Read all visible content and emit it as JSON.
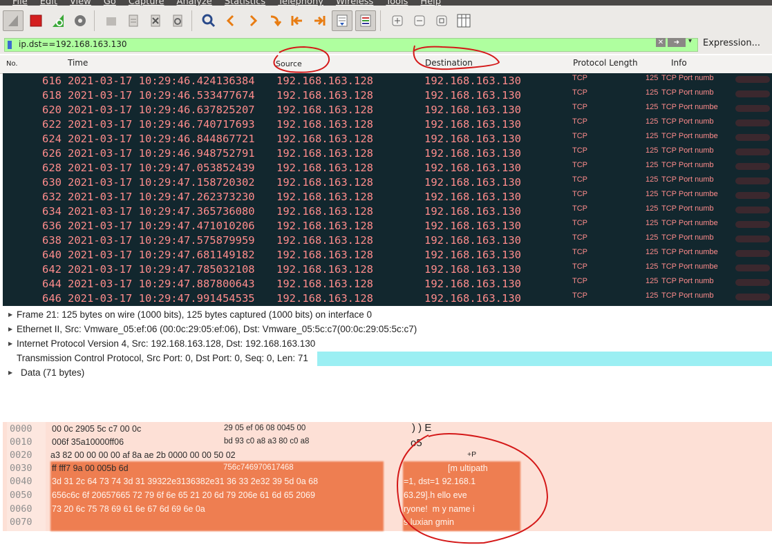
{
  "menubar": {
    "items": [
      "File",
      "Edit",
      "View",
      "Go",
      "Capture",
      "Analyze",
      "Statistics",
      "Telephony",
      "Wireless",
      "Tools",
      "Help"
    ]
  },
  "toolbar": {
    "icons": [
      "shark-fin-icon",
      "stop-capture-icon",
      "restart-capture-icon",
      "capture-options-icon",
      "open-file-icon",
      "save-file-icon",
      "close-file-icon",
      "reload-icon",
      "find-packet-icon",
      "go-back-icon",
      "go-forward-icon",
      "go-to-packet-icon",
      "first-packet-icon",
      "last-packet-icon",
      "autoscroll-icon",
      "colorize-icon",
      "zoom-in-icon",
      "zoom-out-icon",
      "normal-size-icon",
      "resize-columns-icon"
    ]
  },
  "filter": {
    "value": "ip.dst==192.168.163.130",
    "expression_label": "Expression..."
  },
  "columns": {
    "no": "No.",
    "time": "Time",
    "source": "Source",
    "destination": "Destination",
    "protocol": "Protocol",
    "length": "Length",
    "info": "Info"
  },
  "packets": [
    {
      "no": "616",
      "time": "2021-03-17 10:29:46.424136384",
      "src": "192.168.163.128",
      "dst": "192.168.163.130",
      "proto": "TCP",
      "len": "125",
      "info": "TCP Port numb"
    },
    {
      "no": "618",
      "time": "2021-03-17 10:29:46.533477674",
      "src": "192.168.163.128",
      "dst": "192.168.163.130",
      "proto": "TCP",
      "len": "125",
      "info": "TCP Port numb"
    },
    {
      "no": "620",
      "time": "2021-03-17 10:29:46.637825207",
      "src": "192.168.163.128",
      "dst": "192.168.163.130",
      "proto": "TCP",
      "len": "125",
      "info": "TCP Port numbe"
    },
    {
      "no": "622",
      "time": "2021-03-17 10:29:46.740717693",
      "src": "192.168.163.128",
      "dst": "192.168.163.130",
      "proto": "TCP",
      "len": "125",
      "info": "TCP Port numb"
    },
    {
      "no": "624",
      "time": "2021-03-17 10:29:46.844867721",
      "src": "192.168.163.128",
      "dst": "192.168.163.130",
      "proto": "TCP",
      "len": "125",
      "info": "TCP Port numbe"
    },
    {
      "no": "626",
      "time": "2021-03-17 10:29:46.948752791",
      "src": "192.168.163.128",
      "dst": "192.168.163.130",
      "proto": "TCP",
      "len": "125",
      "info": "TCP Port numb"
    },
    {
      "no": "628",
      "time": "2021-03-17 10:29:47.053852439",
      "src": "192.168.163.128",
      "dst": "192.168.163.130",
      "proto": "TCP",
      "len": "125",
      "info": "TCP Port numb"
    },
    {
      "no": "630",
      "time": "2021-03-17 10:29:47.158720302",
      "src": "192.168.163.128",
      "dst": "192.168.163.130",
      "proto": "TCP",
      "len": "125",
      "info": "TCP Port numb"
    },
    {
      "no": "632",
      "time": "2021-03-17 10:29:47.262373230",
      "src": "192.168.163.128",
      "dst": "192.168.163.130",
      "proto": "TCP",
      "len": "125",
      "info": "TCP Port numbe"
    },
    {
      "no": "634",
      "time": "2021-03-17 10:29:47.365736080",
      "src": "192.168.163.128",
      "dst": "192.168.163.130",
      "proto": "TCP",
      "len": "125",
      "info": "TCP Port numb"
    },
    {
      "no": "636",
      "time": "2021-03-17 10:29:47.471010206",
      "src": "192.168.163.128",
      "dst": "192.168.163.130",
      "proto": "TCP",
      "len": "125",
      "info": "TCP Port numbe"
    },
    {
      "no": "638",
      "time": "2021-03-17 10:29:47.575879959",
      "src": "192.168.163.128",
      "dst": "192.168.163.130",
      "proto": "TCP",
      "len": "125",
      "info": "TCP Port numb"
    },
    {
      "no": "640",
      "time": "2021-03-17 10:29:47.681149182",
      "src": "192.168.163.128",
      "dst": "192.168.163.130",
      "proto": "TCP",
      "len": "125",
      "info": "TCP Port numbe"
    },
    {
      "no": "642",
      "time": "2021-03-17 10:29:47.785032108",
      "src": "192.168.163.128",
      "dst": "192.168.163.130",
      "proto": "TCP",
      "len": "125",
      "info": "TCP Port numbe"
    },
    {
      "no": "644",
      "time": "2021-03-17 10:29:47.887800643",
      "src": "192.168.163.128",
      "dst": "192.168.163.130",
      "proto": "TCP",
      "len": "125",
      "info": "TCP Port numb"
    },
    {
      "no": "646",
      "time": "2021-03-17 10:29:47.991454535",
      "src": "192.168.163.128",
      "dst": "192.168.163.130",
      "proto": "TCP",
      "len": "125",
      "info": "TCP Port numb"
    }
  ],
  "details": [
    "Frame 21: 125 bytes on wire (1000 bits), 125 bytes captured (1000 bits) on interface 0",
    "Ethernet II, Src: Vmware_05:ef:06 (00:0c:29:05:ef:06), Dst: Vmware_05:5c:c7(00:0c:29:05:5c:c7)",
    "Internet Protocol Version 4, Src: 192.168.163.128, Dst: 192.168.163.130",
    "Transmission Control Protocol, Src Port: 0, Dst Port: 0, Seq: 0, Len: 71",
    "Data (71 bytes)"
  ],
  "bytes": {
    "offsets": [
      "0000",
      "0010",
      "0020",
      "0030",
      "0040",
      "0050",
      "0060",
      "0070"
    ],
    "hex_left": [
      "00 0c 2905 5c c7 00 0c",
      "006f 35a10000ff06",
      "a3 82 00 00 00 00 af 8a ae 2b 0000 00 00 50 02",
      "ff fff7 9a 00 005b 6d",
      "3d 31 2c 64 73 74 3d 31 39322e3136382e31 36 33 2e32 39 5d 0a 68",
      "656c6c 6f 20657665 72 79 6f 6e 65 21 20 6d 79 206e 61 6d 65 2069",
      "73 20 6c 75 78 69 61 6e 67 6d 69 6e 0a",
      ""
    ],
    "hex_right": [
      "29 05 ef 06 08 0045 00",
      "bd 93 c0 a8 a3 80 c0 a8",
      "",
      "756c746970617468",
      "",
      "",
      "",
      ""
    ],
    "ascii": [
      ") ) E",
      "o5",
      "+P",
      "[m ultipath",
      "=1, dst=1 92.168.1",
      "63.29].h ello eve",
      "ryone!  m y name i",
      "s luxian gmin"
    ]
  },
  "colors": {
    "list_bg": "#12272e",
    "list_fg": "#ff8c8c",
    "filter_ok": "#afff9f",
    "selected_detail": "#9beff3",
    "bytes_bg": "#fde0d6",
    "highlight": "#ee7e51",
    "annotation": "#d41818"
  }
}
